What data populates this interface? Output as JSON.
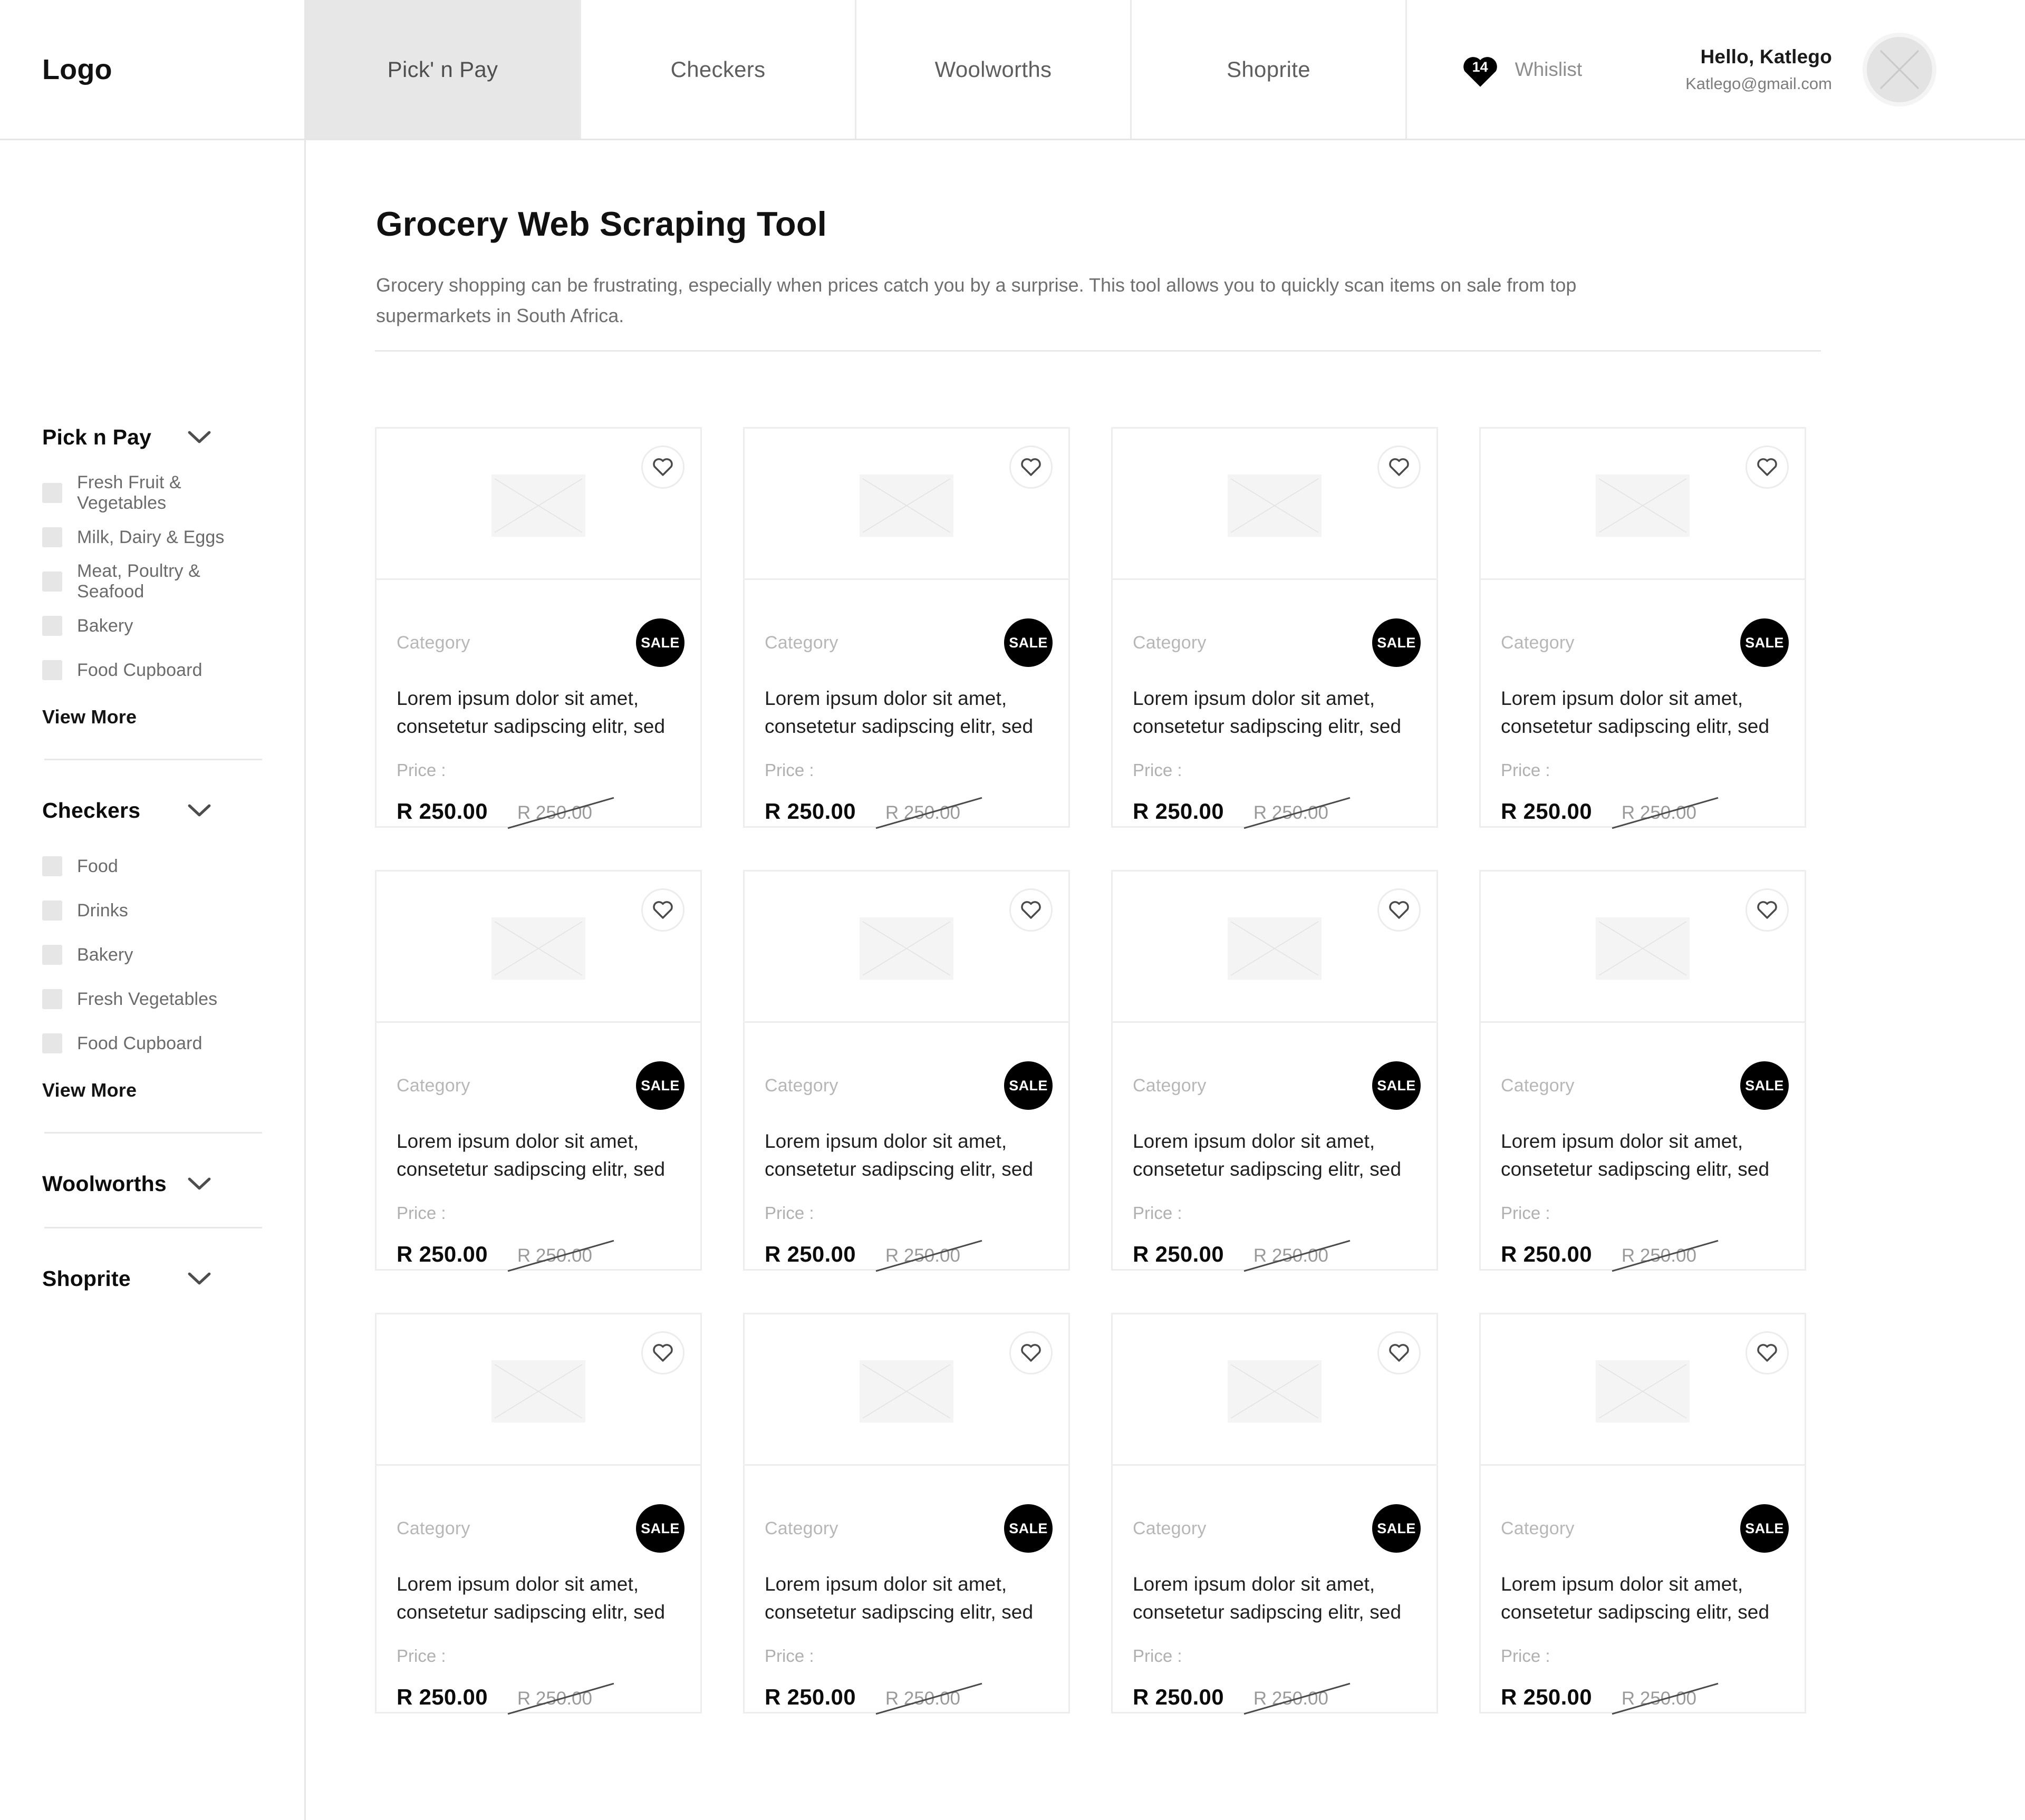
{
  "header": {
    "logo": "Logo",
    "tabs": [
      {
        "label": "Pick' n Pay",
        "active": true
      },
      {
        "label": "Checkers",
        "active": false
      },
      {
        "label": "Woolworths",
        "active": false
      },
      {
        "label": "Shoprite",
        "active": false
      }
    ],
    "wishlist": {
      "label": "Whislist",
      "count": "14",
      "icon": "heart-icon"
    },
    "user": {
      "greeting": "Hello, Katlego",
      "email": "Katlego@gmail.com",
      "avatar_icon": "image-placeholder-icon"
    }
  },
  "sidebar": {
    "groups": [
      {
        "title": "Pick n Pay",
        "expanded": true,
        "items": [
          "Fresh Fruit & Vegetables",
          "Milk, Dairy & Eggs",
          "Meat, Poultry & Seafood",
          "Bakery",
          "Food Cupboard"
        ],
        "view_more": "View More"
      },
      {
        "title": "Checkers",
        "expanded": true,
        "items": [
          "Food",
          "Drinks",
          "Bakery",
          "Fresh Vegetables",
          "Food Cupboard"
        ],
        "view_more": "View More"
      },
      {
        "title": "Woolworths",
        "expanded": false,
        "items": [],
        "view_more": ""
      },
      {
        "title": "Shoprite",
        "expanded": false,
        "items": [],
        "view_more": ""
      }
    ]
  },
  "main": {
    "title": "Grocery Web Scraping Tool",
    "description": "Grocery shopping can be frustrating, especially when prices catch you by a surprise. This tool allows you to quickly scan items on sale from top supermarkets in South Africa."
  },
  "product_template": {
    "category": "Category",
    "name": "Lorem ipsum dolor sit amet, consetetur sadipscing elitr, sed",
    "price_label": "Price :",
    "price_new": "R 250.00",
    "price_old": "R 250.00",
    "badge": "SALE"
  },
  "products": [
    {
      "category": "Category",
      "name": "Lorem ipsum dolor sit amet, consetetur sadipscing elitr, sed",
      "price_label": "Price :",
      "price_new": "R 250.00",
      "price_old": "R 250.00",
      "badge": "SALE"
    },
    {
      "category": "Category",
      "name": "Lorem ipsum dolor sit amet, consetetur sadipscing elitr, sed",
      "price_label": "Price :",
      "price_new": "R 250.00",
      "price_old": "R 250.00",
      "badge": "SALE"
    },
    {
      "category": "Category",
      "name": "Lorem ipsum dolor sit amet, consetetur sadipscing elitr, sed",
      "price_label": "Price :",
      "price_new": "R 250.00",
      "price_old": "R 250.00",
      "badge": "SALE"
    },
    {
      "category": "Category",
      "name": "Lorem ipsum dolor sit amet, consetetur sadipscing elitr, sed",
      "price_label": "Price :",
      "price_new": "R 250.00",
      "price_old": "R 250.00",
      "badge": "SALE"
    },
    {
      "category": "Category",
      "name": "Lorem ipsum dolor sit amet, consetetur sadipscing elitr, sed",
      "price_label": "Price :",
      "price_new": "R 250.00",
      "price_old": "R 250.00",
      "badge": "SALE"
    },
    {
      "category": "Category",
      "name": "Lorem ipsum dolor sit amet, consetetur sadipscing elitr, sed",
      "price_label": "Price :",
      "price_new": "R 250.00",
      "price_old": "R 250.00",
      "badge": "SALE"
    },
    {
      "category": "Category",
      "name": "Lorem ipsum dolor sit amet, consetetur sadipscing elitr, sed",
      "price_label": "Price :",
      "price_new": "R 250.00",
      "price_old": "R 250.00",
      "badge": "SALE"
    },
    {
      "category": "Category",
      "name": "Lorem ipsum dolor sit amet, consetetur sadipscing elitr, sed",
      "price_label": "Price :",
      "price_new": "R 250.00",
      "price_old": "R 250.00",
      "badge": "SALE"
    },
    {
      "category": "Category",
      "name": "Lorem ipsum dolor sit amet, consetetur sadipscing elitr, sed",
      "price_label": "Price :",
      "price_new": "R 250.00",
      "price_old": "R 250.00",
      "badge": "SALE"
    },
    {
      "category": "Category",
      "name": "Lorem ipsum dolor sit amet, consetetur sadipscing elitr, sed",
      "price_label": "Price :",
      "price_new": "R 250.00",
      "price_old": "R 250.00",
      "badge": "SALE"
    },
    {
      "category": "Category",
      "name": "Lorem ipsum dolor sit amet, consetetur sadipscing elitr, sed",
      "price_label": "Price :",
      "price_new": "R 250.00",
      "price_old": "R 250.00",
      "badge": "SALE"
    },
    {
      "category": "Category",
      "name": "Lorem ipsum dolor sit amet, consetetur sadipscing elitr, sed",
      "price_label": "Price :",
      "price_new": "R 250.00",
      "price_old": "R 250.00",
      "badge": "SALE"
    }
  ],
  "colors": {
    "accent": "#000000",
    "border": "#ededed",
    "muted": "#b7b7b7",
    "active_tab_bg": "#e7e7e7"
  }
}
